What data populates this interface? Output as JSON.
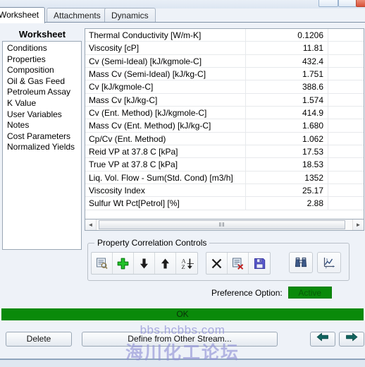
{
  "window": {
    "controls": [
      "minimize-button",
      "maximize-button",
      "close-button"
    ]
  },
  "tabs": [
    {
      "label": "Worksheet",
      "active": true
    },
    {
      "label": "Attachments",
      "active": false
    },
    {
      "label": "Dynamics",
      "active": false
    }
  ],
  "sidebar": {
    "title": "Worksheet",
    "items": [
      {
        "label": "Conditions",
        "selected": false
      },
      {
        "label": "Properties",
        "selected": true
      },
      {
        "label": "Composition",
        "selected": false
      },
      {
        "label": "Oil & Gas Feed",
        "selected": false
      },
      {
        "label": "Petroleum Assay",
        "selected": false
      },
      {
        "label": "K Value",
        "selected": false
      },
      {
        "label": "User Variables",
        "selected": false
      },
      {
        "label": "Notes",
        "selected": false
      },
      {
        "label": "Cost Parameters",
        "selected": false
      },
      {
        "label": "Normalized Yields",
        "selected": false
      }
    ]
  },
  "grid": {
    "rows": [
      {
        "name": "Thermal Conductivity [W/m-K]",
        "value": "0.1206"
      },
      {
        "name": "Viscosity [cP]",
        "value": "11.81"
      },
      {
        "name": "Cv (Semi-Ideal) [kJ/kgmole-C]",
        "value": "432.4"
      },
      {
        "name": "Mass Cv (Semi-Ideal) [kJ/kg-C]",
        "value": "1.751"
      },
      {
        "name": "Cv [kJ/kgmole-C]",
        "value": "388.6"
      },
      {
        "name": "Mass Cv [kJ/kg-C]",
        "value": "1.574"
      },
      {
        "name": "Cv (Ent. Method) [kJ/kgmole-C]",
        "value": "414.9"
      },
      {
        "name": "Mass Cv (Ent. Method) [kJ/kg-C]",
        "value": "1.680"
      },
      {
        "name": "Cp/Cv (Ent. Method)",
        "value": "1.062"
      },
      {
        "name": "Reid VP at 37.8 C [kPa]",
        "value": "17.53"
      },
      {
        "name": "True VP at 37.8 C [kPa]",
        "value": "18.53"
      },
      {
        "name": "Liq. Vol. Flow - Sum(Std. Cond) [m3/h]",
        "value": "1352"
      },
      {
        "name": "Viscosity Index",
        "value": "25.17"
      },
      {
        "name": "Sulfur Wt Pct[Petrol] [%]",
        "value": "2.88"
      }
    ],
    "scrollbar": {
      "left_arrow": "◄",
      "right_arrow": "►",
      "thumb_grip": "‖‖"
    }
  },
  "property_correlation_controls": {
    "legend": "Property Correlation Controls",
    "group_one": [
      {
        "icon": "view-properties-icon"
      },
      {
        "icon": "add-plus-icon"
      },
      {
        "icon": "move-down-icon"
      },
      {
        "icon": "move-up-icon"
      },
      {
        "icon": "sort-az-icon"
      }
    ],
    "group_two": [
      {
        "icon": "delete-x-icon"
      },
      {
        "icon": "clear-all-icon"
      },
      {
        "icon": "save-disk-icon"
      }
    ],
    "group_three": [
      {
        "icon": "binoculars-search-icon"
      },
      {
        "icon": "plot-chart-icon"
      }
    ]
  },
  "preference": {
    "label": "Preference Option:",
    "value": "Active"
  },
  "status": {
    "message": "OK"
  },
  "footer": {
    "delete_label": "Delete",
    "define_label": "Define from Other Stream...",
    "prev_arrow": "⬅",
    "next_arrow": "➡"
  },
  "watermark": {
    "line1": "bbs.hcbbs.com",
    "line2": "海川化工论坛"
  },
  "colors": {
    "status_green": "#0a8a0a",
    "badge_green": "#0a8a0a",
    "app_background": "#eef2f8"
  }
}
